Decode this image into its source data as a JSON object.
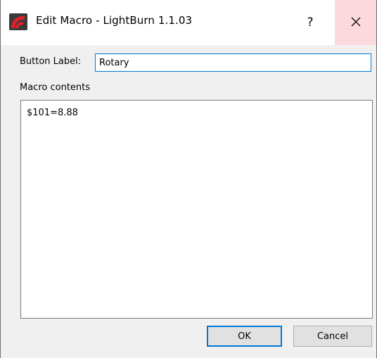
{
  "window": {
    "title": "Edit Macro - LightBurn 1.1.03",
    "icon": "lightburn-logo-icon",
    "help_glyph": "?",
    "close_icon": "close-icon",
    "close_hover_color": "#fcd9dc"
  },
  "form": {
    "button_label_caption": "Button Label:",
    "button_label_value": "Rotary",
    "macro_contents_caption": "Macro contents",
    "macro_contents_value": "$101=8.88"
  },
  "actions": {
    "ok_label": "OK",
    "cancel_label": "Cancel",
    "accent_color": "#0078d7"
  }
}
